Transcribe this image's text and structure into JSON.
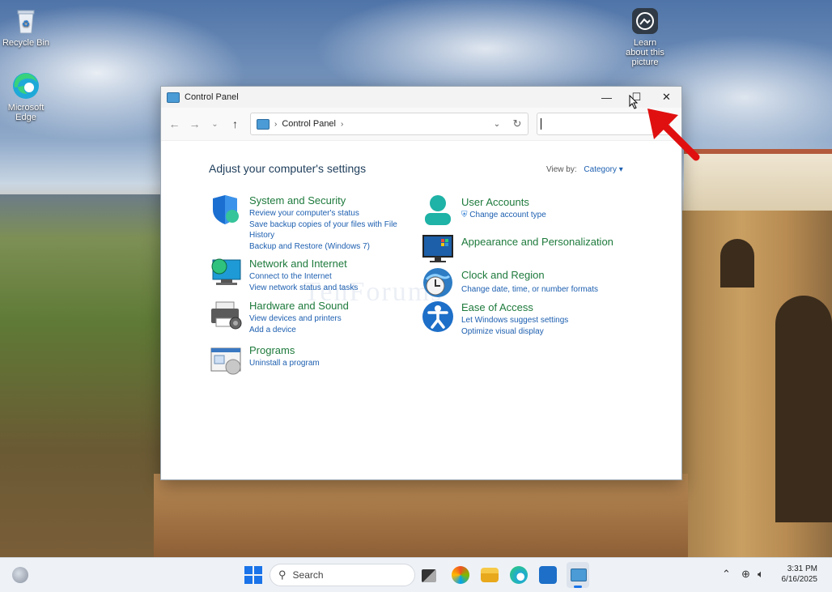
{
  "desktop": {
    "icons": [
      {
        "label": "Recycle Bin"
      },
      {
        "label": "Microsoft Edge"
      },
      {
        "label": "Learn about this picture"
      }
    ]
  },
  "window": {
    "title": "Control Panel",
    "controls": {
      "minimize": "—",
      "maximize": "☐",
      "close": "✕"
    },
    "address": {
      "crumb": "Control Panel"
    },
    "search": {
      "value": "",
      "placeholder": ""
    }
  },
  "content": {
    "heading": "Adjust your computer's settings",
    "view_by_label": "View by:",
    "view_by_value": "Category",
    "watermark": "TenForums",
    "categories": [
      {
        "title": "System and Security",
        "links": [
          "Review your computer's status",
          "Save backup copies of your files with File History",
          "Backup and Restore (Windows 7)"
        ]
      },
      {
        "title": "Network and Internet",
        "links": [
          "Connect to the Internet",
          "View network status and tasks"
        ]
      },
      {
        "title": "Hardware and Sound",
        "links": [
          "View devices and printers",
          "Add a device"
        ]
      },
      {
        "title": "Programs",
        "links": [
          "Uninstall a program"
        ]
      },
      {
        "title": "User Accounts",
        "links": [
          "Change account type"
        ]
      },
      {
        "title": "Appearance and Personalization",
        "links": []
      },
      {
        "title": "Clock and Region",
        "links": [
          "Change date, time, or number formats"
        ]
      },
      {
        "title": "Ease of Access",
        "links": [
          "Let Windows suggest settings",
          "Optimize visual display"
        ]
      }
    ]
  },
  "taskbar": {
    "search_label": "Search",
    "time": "3:31 PM",
    "date": "6/16/2025"
  },
  "colors": {
    "link": "#1d5fb0",
    "category_title": "#1e7a3c",
    "arrow": "#e01010"
  }
}
